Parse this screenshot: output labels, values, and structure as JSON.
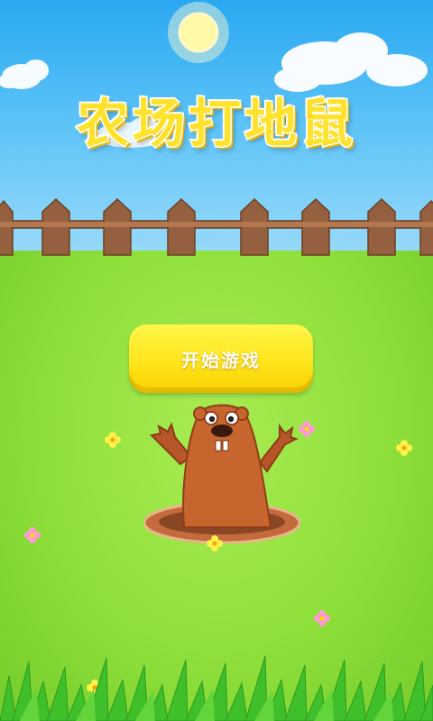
{
  "game": {
    "title": "农场打地鼠",
    "start_button_label": "开始游戏"
  },
  "colors": {
    "sky": "#2aa8f2",
    "grass": "#8fdf3b",
    "button": "#ffe51c",
    "fence": "#8b5a3c",
    "mole": "#c7652e"
  }
}
